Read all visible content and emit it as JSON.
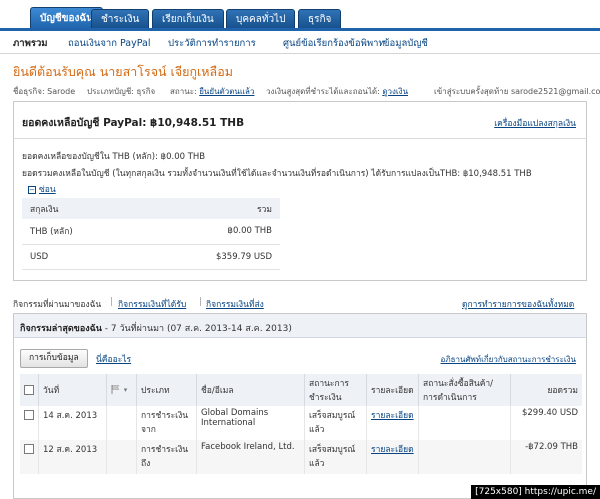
{
  "tabs": [
    {
      "label": "บัญชีของฉัน",
      "active": true
    },
    {
      "label": "ชำระเงิน",
      "active": false
    },
    {
      "label": "เรียกเก็บเงิน",
      "active": false
    },
    {
      "label": "บุคคลทั่วไป",
      "active": false
    },
    {
      "label": "ธุรกิจ",
      "active": false
    }
  ],
  "subnav": [
    {
      "label": "ภาพรวม",
      "active": true
    },
    {
      "label": "ถอนเงินจาก PayPal",
      "active": false
    },
    {
      "label": "ประวัติการทำรายการ",
      "active": false
    },
    {
      "label": "ศูนย์ข้อเรียกร้องข้อพิพาท",
      "active": false
    },
    {
      "label": "ข้อมูลบัญชี",
      "active": false
    }
  ],
  "welcome": "ยินดีต้อนรับคุณ นายสาโรจน์ เจียกูเหลือม",
  "meta": {
    "business_name": "ชื่อธุรกิจ: Sarode",
    "account_type": "ประเภทบัญชี: ธุรกิจ",
    "status_label": "สถานะ:",
    "status_value": "ยืนยันตัวตนแล้ว",
    "limit_label": "วงเงินสูงสุดที่ชำระได้และถอนได้:",
    "limit_value": "ดูวงเงิน",
    "last_login": "เข้าสู่ระบบครั้งสุดท้าย sarode2521@gmail.co"
  },
  "balance": {
    "heading": "ยอดคงเหลือบัญชี PayPal: ฿10,948.51 THB",
    "tools_link": "เครื่องมือแปลงสกุลเงิน",
    "primary_line": "ยอดคงเหลือของบัญชีใน THB (หลัก): ฿0.00 THB",
    "total_line": "ยอดรวมคงเหลือในบัญชี (ในทุกสกุลเงิน รวมทั้งจำนวนเงินที่ใช้ได้และจำนวนเงินที่รอดำเนินการ) ได้รับการแปลงเป็นTHB: ฿10,948.51 THB",
    "collapse_label": "ซ่อน",
    "table_head": {
      "currency": "สกุลเงิน",
      "total": "รวม"
    },
    "rows": [
      {
        "currency": "THB (หลัก)",
        "total": "฿0.00 THB"
      },
      {
        "currency": "USD",
        "total": "$359.79 USD"
      }
    ]
  },
  "activity_nav": {
    "static": "กิจกรรมที่ผ่านมาของฉัน",
    "received": "กิจกรรมเงินที่ได้รับ",
    "sent": "กิจกรรมเงินที่ส่ง",
    "all": "ดูการทำรายการของฉันทั้งหมด"
  },
  "activity": {
    "title_bold": "กิจกรรมล่าสุดของฉัน",
    "title_rest": " - 7 วันที่ผ่านมา (07 ส.ค. 2013-14 ส.ค. 2013)",
    "archive_button": "การเก็บข้อมูล",
    "whats_this": "นี่คืออะไร",
    "legend_link": "อภิธานศัพท์เกี่ยวกับสถานะการชำระเงิน",
    "columns": [
      "วันที่",
      "ประเภท",
      "ชื่อ/อีเมล",
      "สถานะการชำระเงิน",
      "รายละเอียด",
      "สถานะสั่งซื้อสินค้า/การดำเนินการ",
      "ยอดรวม"
    ],
    "rows": [
      {
        "date": "14 ส.ค. 2013",
        "type": "การชำระเงิน จาก",
        "name": "Global Domains International",
        "status": "เสร็จสมบูรณ์แล้ว",
        "detail": "รายละเอียด",
        "order": "",
        "amount": "$299.40 USD"
      },
      {
        "date": "12 ส.ค. 2013",
        "type": "การชำระเงิน ถึง",
        "name": "Facebook Ireland, Ltd.",
        "status": "เสร็จสมบูรณ์แล้ว",
        "detail": "รายละเอียด",
        "order": "",
        "amount": "-฿72.09 THB"
      }
    ]
  },
  "watermark": "[725x580] https://upic.me/"
}
